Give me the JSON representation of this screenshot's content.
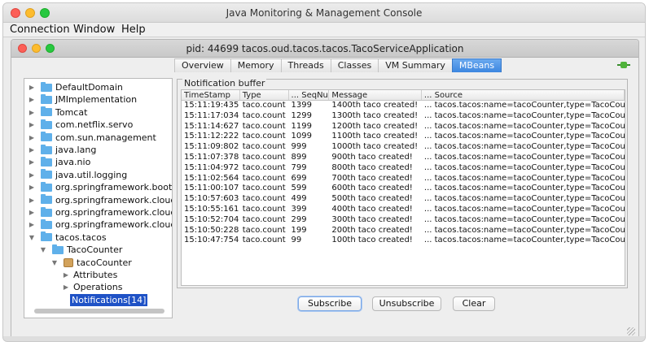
{
  "window": {
    "title": "Java Monitoring & Management Console"
  },
  "menu": {
    "items": [
      "Connection",
      "Window",
      "Help"
    ]
  },
  "inner_window": {
    "title": "pid: 44699 tacos.oud.tacos.tacos.TacoServiceApplication"
  },
  "tabs": [
    "Overview",
    "Memory",
    "Threads",
    "Classes",
    "VM Summary",
    "MBeans"
  ],
  "active_tab": "MBeans",
  "tree": [
    {
      "label": "DefaultDomain",
      "type": "folder",
      "depth": 0,
      "expanded": false
    },
    {
      "label": "JMImplementation",
      "type": "folder",
      "depth": 0,
      "expanded": false
    },
    {
      "label": "Tomcat",
      "type": "folder",
      "depth": 0,
      "expanded": false
    },
    {
      "label": "com.netflix.servo",
      "type": "folder",
      "depth": 0,
      "expanded": false
    },
    {
      "label": "com.sun.management",
      "type": "folder",
      "depth": 0,
      "expanded": false
    },
    {
      "label": "java.lang",
      "type": "folder",
      "depth": 0,
      "expanded": false
    },
    {
      "label": "java.nio",
      "type": "folder",
      "depth": 0,
      "expanded": false
    },
    {
      "label": "java.util.logging",
      "type": "folder",
      "depth": 0,
      "expanded": false
    },
    {
      "label": "org.springframework.boot",
      "type": "folder",
      "depth": 0,
      "expanded": false
    },
    {
      "label": "org.springframework.cloud.cc",
      "type": "folder",
      "depth": 0,
      "expanded": false
    },
    {
      "label": "org.springframework.cloud.cc",
      "type": "folder",
      "depth": 0,
      "expanded": false
    },
    {
      "label": "org.springframework.cloud.cc",
      "type": "folder",
      "depth": 0,
      "expanded": false
    },
    {
      "label": "tacos.tacos",
      "type": "folder",
      "depth": 0,
      "expanded": true
    },
    {
      "label": "TacoCounter",
      "type": "folder",
      "depth": 1,
      "expanded": true
    },
    {
      "label": "tacoCounter",
      "type": "bean",
      "depth": 2,
      "expanded": true
    },
    {
      "label": "Attributes",
      "type": "leaf",
      "depth": 3,
      "expanded": false
    },
    {
      "label": "Operations",
      "type": "leaf",
      "depth": 3,
      "expanded": false
    },
    {
      "label": "Notifications[14]",
      "type": "selected",
      "depth": 3,
      "expanded": false
    }
  ],
  "notifications": {
    "title": "Notification buffer",
    "columns": [
      "TimeStamp",
      "Type",
      "... SeqNum",
      "Message",
      "... Source"
    ],
    "rows": [
      [
        "15:11:19:435",
        "taco.count",
        "1399",
        "1400th taco created!",
        "... tacos.tacos:name=tacoCounter,type=TacoCounte..."
      ],
      [
        "15:11:17:034",
        "taco.count",
        "1299",
        "1300th taco created!",
        "... tacos.tacos:name=tacoCounter,type=TacoCounte..."
      ],
      [
        "15:11:14:627",
        "taco.count",
        "1199",
        "1200th taco created!",
        "... tacos.tacos:name=tacoCounter,type=TacoCounte..."
      ],
      [
        "15:11:12:222",
        "taco.count",
        "1099",
        "1100th taco created!",
        "... tacos.tacos:name=tacoCounter,type=TacoCounte..."
      ],
      [
        "15:11:09:802",
        "taco.count",
        "999",
        "1000th taco created!",
        "... tacos.tacos:name=tacoCounter,type=TacoCounte..."
      ],
      [
        "15:11:07:378",
        "taco.count",
        "899",
        "900th taco created!",
        "... tacos.tacos:name=tacoCounter,type=TacoCounte..."
      ],
      [
        "15:11:04:972",
        "taco.count",
        "799",
        "800th taco created!",
        "... tacos.tacos:name=tacoCounter,type=TacoCounte..."
      ],
      [
        "15:11:02:564",
        "taco.count",
        "699",
        "700th taco created!",
        "... tacos.tacos:name=tacoCounter,type=TacoCounte..."
      ],
      [
        "15:11:00:107",
        "taco.count",
        "599",
        "600th taco created!",
        "... tacos.tacos:name=tacoCounter,type=TacoCounte..."
      ],
      [
        "15:10:57:603",
        "taco.count",
        "499",
        "500th taco created!",
        "... tacos.tacos:name=tacoCounter,type=TacoCounte..."
      ],
      [
        "15:10:55:161",
        "taco.count",
        "399",
        "400th taco created!",
        "... tacos.tacos:name=tacoCounter,type=TacoCounte..."
      ],
      [
        "15:10:52:704",
        "taco.count",
        "299",
        "300th taco created!",
        "... tacos.tacos:name=tacoCounter,type=TacoCounte..."
      ],
      [
        "15:10:50:228",
        "taco.count",
        "199",
        "200th taco created!",
        "... tacos.tacos:name=tacoCounter,type=TacoCounte..."
      ],
      [
        "15:10:47:754",
        "taco.count",
        "99",
        "100th taco created!",
        "... tacos.tacos:name=tacoCounter,type=TacoCounte..."
      ]
    ]
  },
  "buttons": {
    "subscribe": "Subscribe",
    "unsubscribe": "Unsubscribe",
    "clear": "Clear"
  },
  "colors": {
    "accent": "#3c86e0",
    "selection": "#1f52c6",
    "folder": "#5fb0ea"
  },
  "icons": {
    "plug": "connection-plug-icon",
    "folder": "folder-icon",
    "bean": "mbean-icon"
  }
}
